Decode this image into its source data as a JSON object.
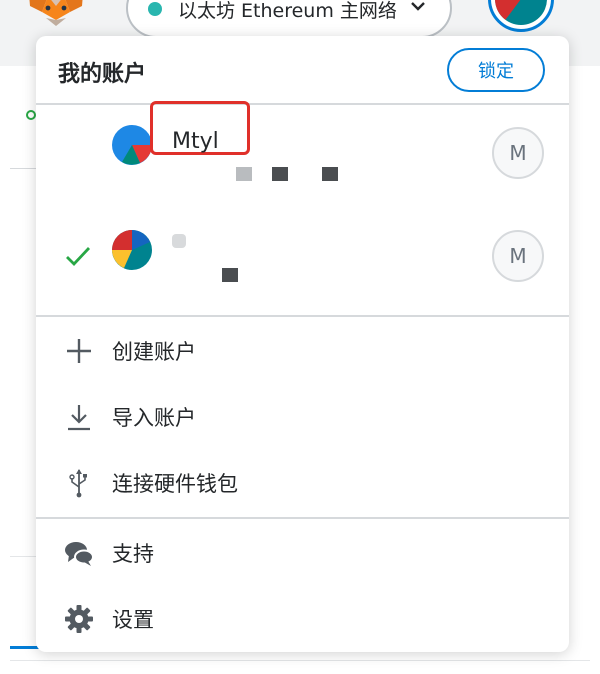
{
  "header": {
    "network_label": "以太坊 Ethereum 主网络",
    "network_status_color": "#29b6af"
  },
  "account_menu": {
    "title": "我的账户",
    "lock_label": "锁定",
    "accounts": [
      {
        "name": "Mtyl",
        "selected": false,
        "keyring_badge": "M",
        "avatar_colors": [
          "#1e88e5",
          "#e53935",
          "#00897b"
        ]
      },
      {
        "name": "",
        "selected": true,
        "keyring_badge": "M",
        "avatar_colors": [
          "#1565c0",
          "#fbc02d",
          "#d32f2f",
          "#00838f"
        ]
      }
    ],
    "actions": [
      {
        "label": "创建账户",
        "icon": "plus-icon"
      },
      {
        "label": "导入账户",
        "icon": "download-icon"
      },
      {
        "label": "连接硬件钱包",
        "icon": "usb-icon"
      }
    ],
    "footer": [
      {
        "label": "支持",
        "icon": "chat-bubbles-icon"
      },
      {
        "label": "设置",
        "icon": "gear-icon"
      }
    ]
  },
  "colors": {
    "accent": "#037dd6",
    "highlight": "#e0302a",
    "check": "#28a745"
  }
}
